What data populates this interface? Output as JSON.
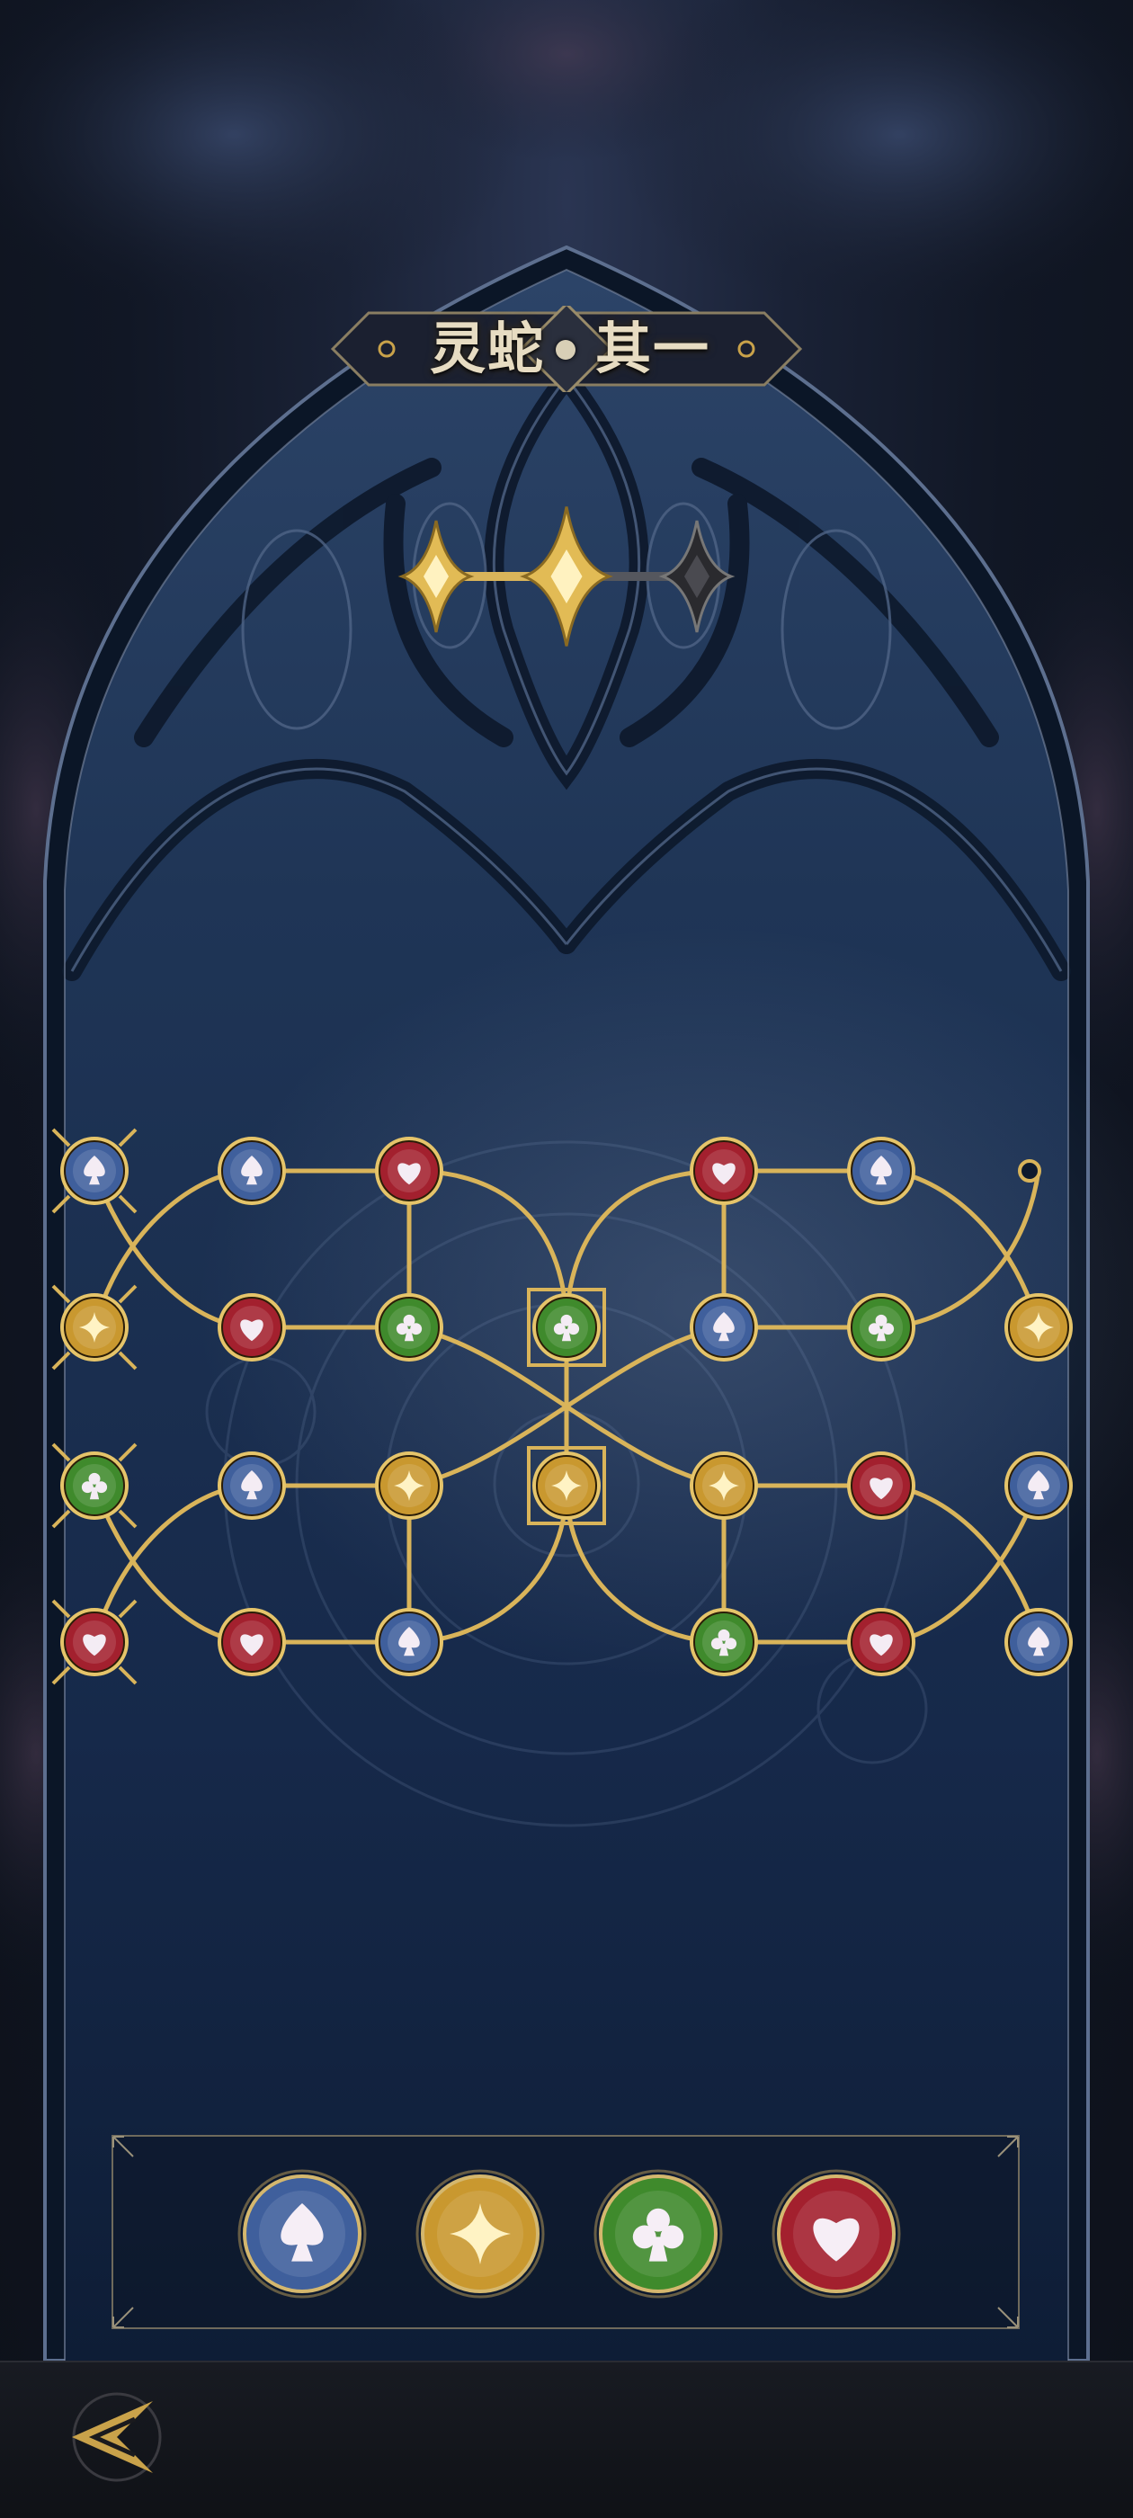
{
  "level": {
    "title_left": "灵蛇",
    "title_right": "其一",
    "stars_earned": 2,
    "stars_total": 3
  },
  "colors": {
    "spade": "#3f5f9c",
    "diamond": "#c9982f",
    "club": "#3f8a2c",
    "heart": "#a3202e",
    "gold_line": "#d9b45a",
    "arch_stone": "#1e3150",
    "frame_dark": "#0b1422"
  },
  "board": {
    "rows": [
      [
        "spade",
        "spade",
        "heart",
        "",
        "heart",
        "spade",
        ""
      ],
      [
        "diamond",
        "heart",
        "club",
        "club",
        "spade",
        "club",
        "diamond"
      ],
      [
        "club",
        "spade",
        "diamond",
        "diamond",
        "diamond",
        "heart",
        "spade"
      ],
      [
        "heart",
        "heart",
        "spade",
        "",
        "club",
        "heart",
        "spade"
      ]
    ],
    "crossed_cells": [
      [
        0,
        0
      ],
      [
        1,
        0
      ],
      [
        2,
        0
      ],
      [
        3,
        0
      ]
    ],
    "selected_cells": [
      [
        1,
        3
      ],
      [
        2,
        3
      ]
    ],
    "end_marker_cell": [
      0,
      6
    ]
  },
  "tray": {
    "items": [
      {
        "suit": "spade",
        "icon": "spade-icon"
      },
      {
        "suit": "diamond",
        "icon": "diamond-icon"
      },
      {
        "suit": "club",
        "icon": "club-icon"
      },
      {
        "suit": "heart",
        "icon": "heart-icon"
      }
    ]
  },
  "nav": {
    "back_icon": "back-arrow-icon"
  }
}
